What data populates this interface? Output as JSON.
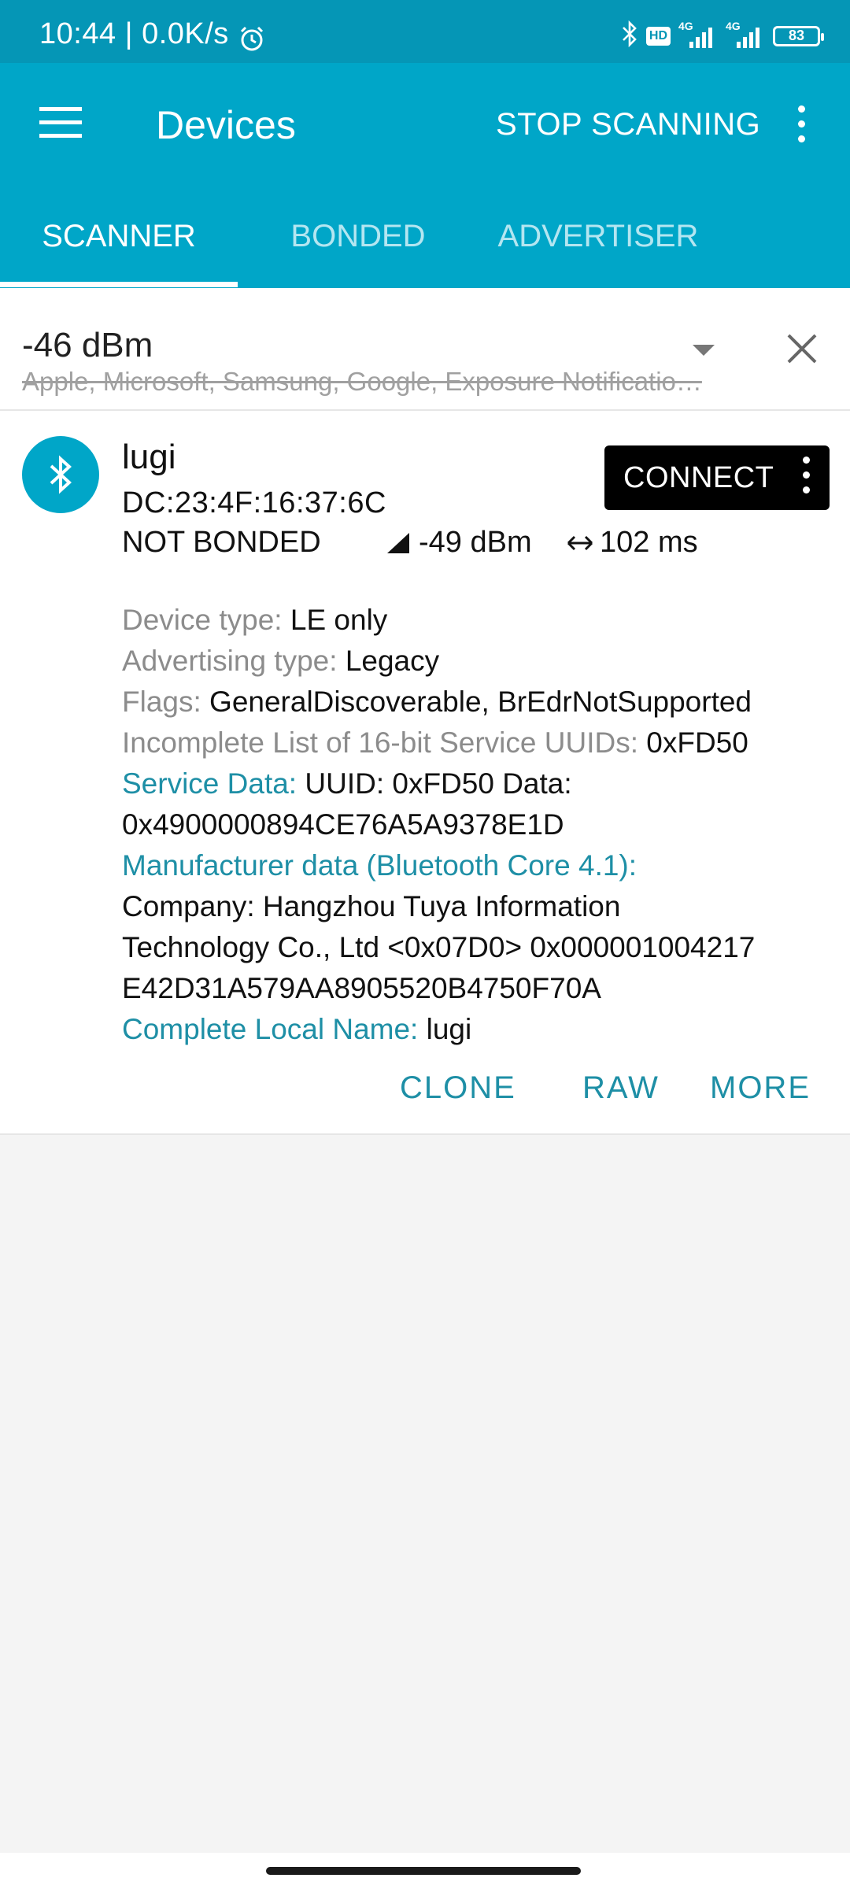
{
  "status_bar": {
    "time_speed": "10:44 | 0.0K/s",
    "network_1": "4G",
    "network_2": "4G",
    "hd": "HD",
    "battery": "83"
  },
  "app_bar": {
    "title": "Devices",
    "stop_label": "STOP SCANNING"
  },
  "tabs": [
    {
      "label": "SCANNER",
      "active": true
    },
    {
      "label": "BONDED",
      "active": false
    },
    {
      "label": "ADVERTISER",
      "active": false
    }
  ],
  "filter": {
    "rssi": "-46 dBm",
    "excluded": "Apple, Microsoft, Samsung, Google, Exposure Notificatio…"
  },
  "device": {
    "name": "lugi",
    "address": "DC:23:4F:16:37:6C",
    "bond_state": "NOT BONDED",
    "rssi": "-49 dBm",
    "interval": "102 ms",
    "connect_label": "CONNECT",
    "device_type_key": "Device type: ",
    "device_type_val": "LE only",
    "adv_type_key": "Advertising type: ",
    "adv_type_val": "Legacy",
    "flags_key": "Flags: ",
    "flags_val": "GeneralDiscoverable, BrEdrNotSupported",
    "uuids_key": "Incomplete List of 16-bit Service UUIDs: ",
    "uuids_val": "0xFD50",
    "service_data_key": "Service Data: ",
    "service_data_line1": "UUID: 0xFD50 Data:",
    "service_data_line2": "0x4900000894CE76A5A9378E1D",
    "manufacturer_key": "Manufacturer data (Bluetooth Core 4.1):",
    "manufacturer_line1": "Company: Hangzhou Tuya Information",
    "manufacturer_line2": "Technology Co., Ltd <0x07D0> 0x000001004217",
    "manufacturer_line3": "E42D31A579AA8905520B4750F70A",
    "local_name_key": "Complete Local Name: ",
    "local_name_val": "lugi"
  },
  "actions": {
    "clone": "CLONE",
    "raw": "RAW",
    "more": "MORE"
  },
  "colors": {
    "status_bar": "#0596b6",
    "app_bar": "#00a6c8",
    "accent_teal": "#1e8fa6",
    "background": "#f4f4f4"
  }
}
